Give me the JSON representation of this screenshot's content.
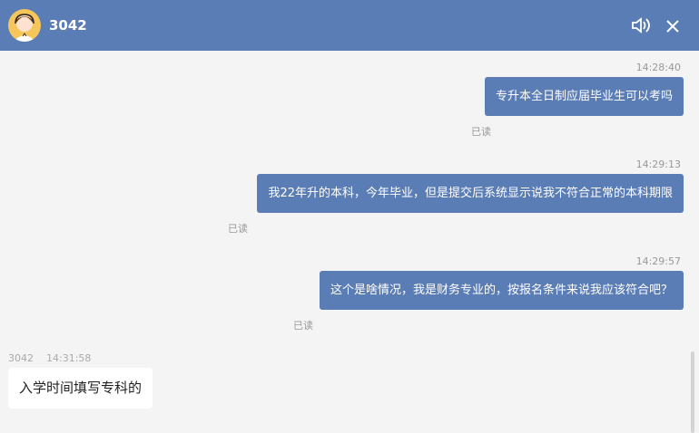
{
  "header": {
    "title": "3042",
    "avatar_icon": "agent-avatar-icon",
    "sound_icon": "speaker-icon",
    "close_icon": "close-icon"
  },
  "messages_out": [
    {
      "time": "14:28:40",
      "text": "专升本全日制应届毕业生可以考吗",
      "status": "已读"
    },
    {
      "time": "14:29:13",
      "text": "我22年升的本科，今年毕业，但是提交后系统显示说我不符合正常的本科期限",
      "status": "已读"
    },
    {
      "time": "14:29:57",
      "text": "这个是啥情况，我是财务专业的，按报名条件来说我应该符合吧？",
      "status": "已读"
    }
  ],
  "message_in": {
    "sender": "3042",
    "time": "14:31:58",
    "text": "入学时间填写专科的"
  },
  "colors": {
    "accent": "#5b7db6",
    "background": "#f4f4f4"
  }
}
